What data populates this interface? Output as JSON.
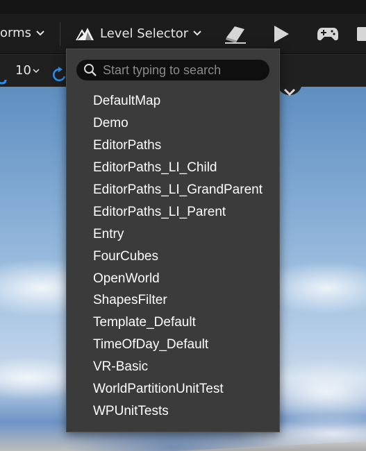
{
  "toolbar": {
    "transforms_label": "orms",
    "level_selector_label": "Level Selector"
  },
  "subbar": {
    "snap_value": "10"
  },
  "level_menu": {
    "search_placeholder": "Start typing to search",
    "items": [
      "DefaultMap",
      "Demo",
      "EditorPaths",
      "EditorPaths_LI_Child",
      "EditorPaths_LI_GrandParent",
      "EditorPaths_LI_Parent",
      "Entry",
      "FourCubes",
      "OpenWorld",
      "ShapesFilter",
      "Template_Default",
      "TimeOfDay_Default",
      "VR-Basic",
      "WorldPartitionUnitTest",
      "WPUnitTests"
    ]
  },
  "icons": {
    "mode": "level-mode-icon",
    "build": "eraser-build-icon",
    "play": "play-icon",
    "gamepad": "gamepad-icon",
    "stop": "stop-icon",
    "snap": "snap-icon",
    "rotate": "rotate-snap-icon",
    "search": "search-icon"
  },
  "colors": {
    "accent_blue": "#2e8fe6",
    "menu_bg": "#3b3b3b",
    "toolbar_bg": "#1c1c1c"
  }
}
